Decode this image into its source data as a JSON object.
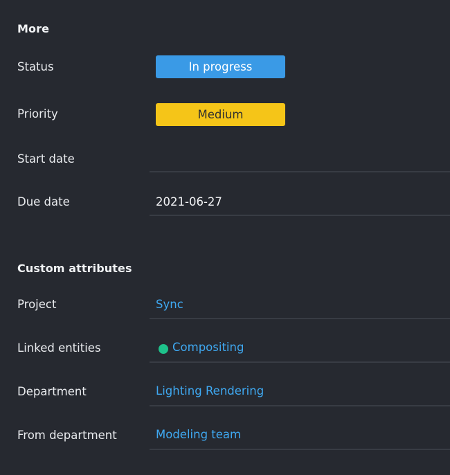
{
  "more": {
    "title": "More",
    "status": {
      "label": "Status",
      "value": "In progress",
      "color": "#3a9ae6"
    },
    "priority": {
      "label": "Priority",
      "value": "Medium",
      "color": "#f5c518"
    },
    "start_date": {
      "label": "Start date",
      "value": ""
    },
    "due_date": {
      "label": "Due date",
      "value": "2021-06-27"
    }
  },
  "custom_attributes": {
    "title": "Custom attributes",
    "project": {
      "label": "Project",
      "value": "Sync"
    },
    "linked_entities": {
      "label": "Linked entities",
      "value": "Compositing",
      "dot_color": "#1ec28b"
    },
    "department": {
      "label": "Department",
      "value": "Lighting Rendering"
    },
    "from_department": {
      "label": "From department",
      "value": "Modeling team"
    }
  },
  "colors": {
    "background": "#262930",
    "link": "#3fa9f2",
    "divider": "#383c44"
  }
}
